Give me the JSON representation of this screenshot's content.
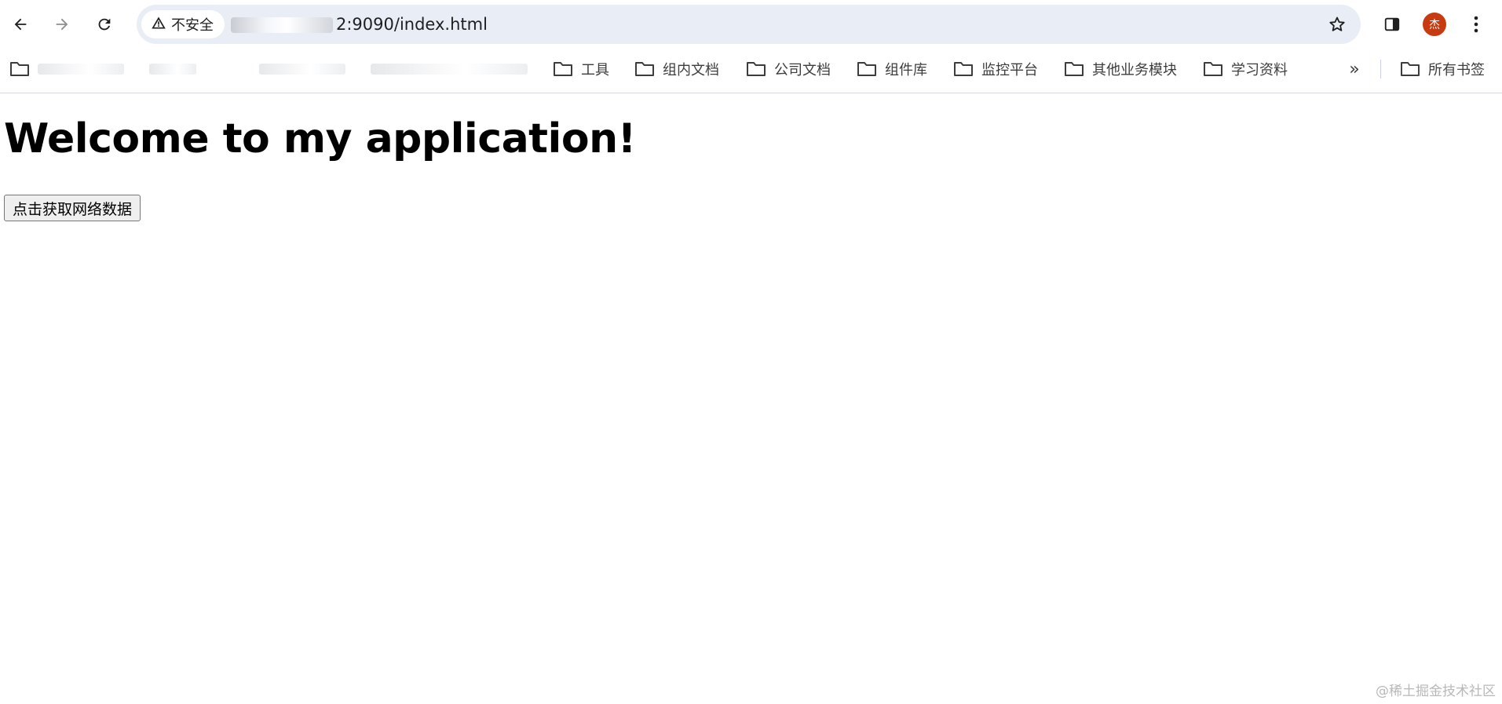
{
  "browser": {
    "security_label": "不安全",
    "url": "2:9090/index.html",
    "avatar_letter": "杰",
    "icons": {
      "back": "back-arrow-icon",
      "forward": "forward-arrow-icon",
      "reload": "reload-icon",
      "warning": "warning-triangle-icon",
      "star": "star-icon",
      "side_panel": "side-panel-icon",
      "menu": "kebab-menu-icon",
      "folder": "folder-icon",
      "more_bookmarks": "chevron-double-right-icon"
    },
    "colors": {
      "omnibox_bg": "#e9edf6",
      "avatar_bg": "#c83a10"
    }
  },
  "bookmarks": {
    "items": [
      {
        "label": "",
        "obscured": true
      },
      {
        "label": "",
        "obscured": true
      },
      {
        "label": "",
        "obscured": true
      },
      {
        "label": "",
        "obscured": true
      },
      {
        "label": "工具"
      },
      {
        "label": "组内文档"
      },
      {
        "label": "公司文档"
      },
      {
        "label": "组件库"
      },
      {
        "label": "监控平台"
      },
      {
        "label": "其他业务模块"
      },
      {
        "label": "学习资料"
      }
    ],
    "more_label": "»",
    "all_bookmarks_label": "所有书签"
  },
  "page": {
    "heading": "Welcome to my application!",
    "button_label": "点击获取网络数据"
  },
  "watermark": "@稀土掘金技术社区"
}
